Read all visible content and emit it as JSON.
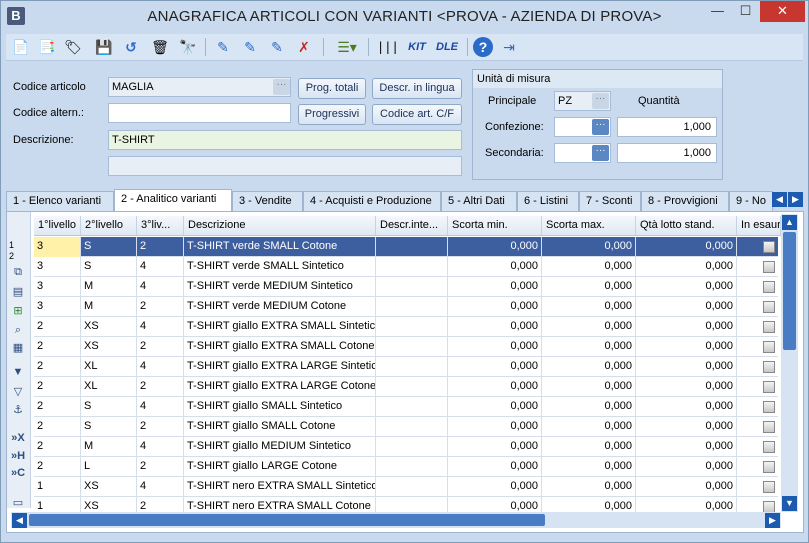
{
  "window": {
    "title": "ANAGRAFICA ARTICOLI CON VARIANTI <PROVA - AZIENDA DI PROVA>",
    "app_letter": "B",
    "minimize": "—",
    "maximize": "☐",
    "close": "✕"
  },
  "toolbar": {
    "icons": [
      "new-doc-icon",
      "copy-icon",
      "tag-icon",
      "save-icon",
      "undo-icon",
      "delete-icon",
      "binoculars-icon",
      "edit-pen-icon",
      "edit-pen2-icon",
      "edit-pen3-icon",
      "edit-cancel-icon",
      "list-menu-icon",
      "barcode-icon",
      "kit-icon",
      "dle-icon",
      "help-icon",
      "exit-icon"
    ],
    "kit_label": "KIT",
    "dle_label": "DLE"
  },
  "form": {
    "codice_articolo_label": "Codice articolo",
    "codice_articolo_value": "MAGLIA",
    "codice_altern_label": "Codice altern.:",
    "codice_altern_value": "",
    "descrizione_label": "Descrizione:",
    "descrizione_value": "T-SHIRT",
    "descrizione2_value": "",
    "btn_prog_totali": "Prog. totali",
    "btn_descr_lingua": "Descr. in lingua",
    "btn_progressivi": "Progressivi",
    "btn_codice_cf": "Codice art. C/F",
    "dots": "···"
  },
  "unita_misura": {
    "title": "Unità di misura",
    "principale_label": "Principale",
    "principale_value": "PZ",
    "quantita_label": "Quantità",
    "confezione_label": "Confezione:",
    "confezione_value": "",
    "confezione_qty": "1,000",
    "secondaria_label": "Secondaria:",
    "secondaria_value": "",
    "secondaria_qty": "1,000"
  },
  "tabs": [
    {
      "label": "1 - Elenco varianti"
    },
    {
      "label": "2 - Analitico varianti"
    },
    {
      "label": "3 - Vendite"
    },
    {
      "label": "4 - Acquisti e Produzione"
    },
    {
      "label": "5 - Altri Dati"
    },
    {
      "label": "6 - Listini"
    },
    {
      "label": "7 - Sconti"
    },
    {
      "label": "8 - Provvigioni"
    },
    {
      "label": "9 - No"
    }
  ],
  "grid": {
    "columns": [
      "1°livello",
      "2°livello",
      "3°liv...",
      "Descrizione",
      "Descr.inte...",
      "Scorta min.",
      "Scorta max.",
      "Qtà lotto stand.",
      "In esaur"
    ],
    "row_markers": [
      "1",
      "2"
    ],
    "rows": [
      {
        "l1": "3",
        "l2": "S",
        "l3": "2",
        "desc": "T-SHIRT verde SMALL Cotone",
        "dint": "",
        "smin": "0,000",
        "smax": "0,000",
        "qlotto": "0,000"
      },
      {
        "l1": "3",
        "l2": "S",
        "l3": "4",
        "desc": "T-SHIRT verde SMALL Sintetico",
        "dint": "",
        "smin": "0,000",
        "smax": "0,000",
        "qlotto": "0,000"
      },
      {
        "l1": "3",
        "l2": "M",
        "l3": "4",
        "desc": "T-SHIRT verde MEDIUM Sintetico",
        "dint": "",
        "smin": "0,000",
        "smax": "0,000",
        "qlotto": "0,000"
      },
      {
        "l1": "3",
        "l2": "M",
        "l3": "2",
        "desc": "T-SHIRT verde MEDIUM Cotone",
        "dint": "",
        "smin": "0,000",
        "smax": "0,000",
        "qlotto": "0,000"
      },
      {
        "l1": "2",
        "l2": "XS",
        "l3": "4",
        "desc": "T-SHIRT giallo EXTRA SMALL Sintetico",
        "dint": "",
        "smin": "0,000",
        "smax": "0,000",
        "qlotto": "0,000"
      },
      {
        "l1": "2",
        "l2": "XS",
        "l3": "2",
        "desc": "T-SHIRT giallo EXTRA SMALL Cotone",
        "dint": "",
        "smin": "0,000",
        "smax": "0,000",
        "qlotto": "0,000"
      },
      {
        "l1": "2",
        "l2": "XL",
        "l3": "4",
        "desc": "T-SHIRT giallo EXTRA LARGE Sintetico",
        "dint": "",
        "smin": "0,000",
        "smax": "0,000",
        "qlotto": "0,000"
      },
      {
        "l1": "2",
        "l2": "XL",
        "l3": "2",
        "desc": "T-SHIRT giallo EXTRA LARGE Cotone",
        "dint": "",
        "smin": "0,000",
        "smax": "0,000",
        "qlotto": "0,000"
      },
      {
        "l1": "2",
        "l2": "S",
        "l3": "4",
        "desc": "T-SHIRT giallo SMALL Sintetico",
        "dint": "",
        "smin": "0,000",
        "smax": "0,000",
        "qlotto": "0,000"
      },
      {
        "l1": "2",
        "l2": "S",
        "l3": "2",
        "desc": "T-SHIRT giallo SMALL Cotone",
        "dint": "",
        "smin": "0,000",
        "smax": "0,000",
        "qlotto": "0,000"
      },
      {
        "l1": "2",
        "l2": "M",
        "l3": "4",
        "desc": "T-SHIRT giallo MEDIUM Sintetico",
        "dint": "",
        "smin": "0,000",
        "smax": "0,000",
        "qlotto": "0,000"
      },
      {
        "l1": "2",
        "l2": "L",
        "l3": "2",
        "desc": "T-SHIRT giallo LARGE Cotone",
        "dint": "",
        "smin": "0,000",
        "smax": "0,000",
        "qlotto": "0,000"
      },
      {
        "l1": "1",
        "l2": "XS",
        "l3": "4",
        "desc": "T-SHIRT nero EXTRA SMALL Sintetico",
        "dint": "",
        "smin": "0,000",
        "smax": "0,000",
        "qlotto": "0,000"
      },
      {
        "l1": "1",
        "l2": "XS",
        "l3": "2",
        "desc": "T-SHIRT nero EXTRA SMALL Cotone",
        "dint": "",
        "smin": "0,000",
        "smax": "0,000",
        "qlotto": "0,000"
      }
    ]
  },
  "colors": {
    "selection": "#3e5f9f",
    "accent": "#1d5bb0",
    "close": "#c7372f"
  }
}
